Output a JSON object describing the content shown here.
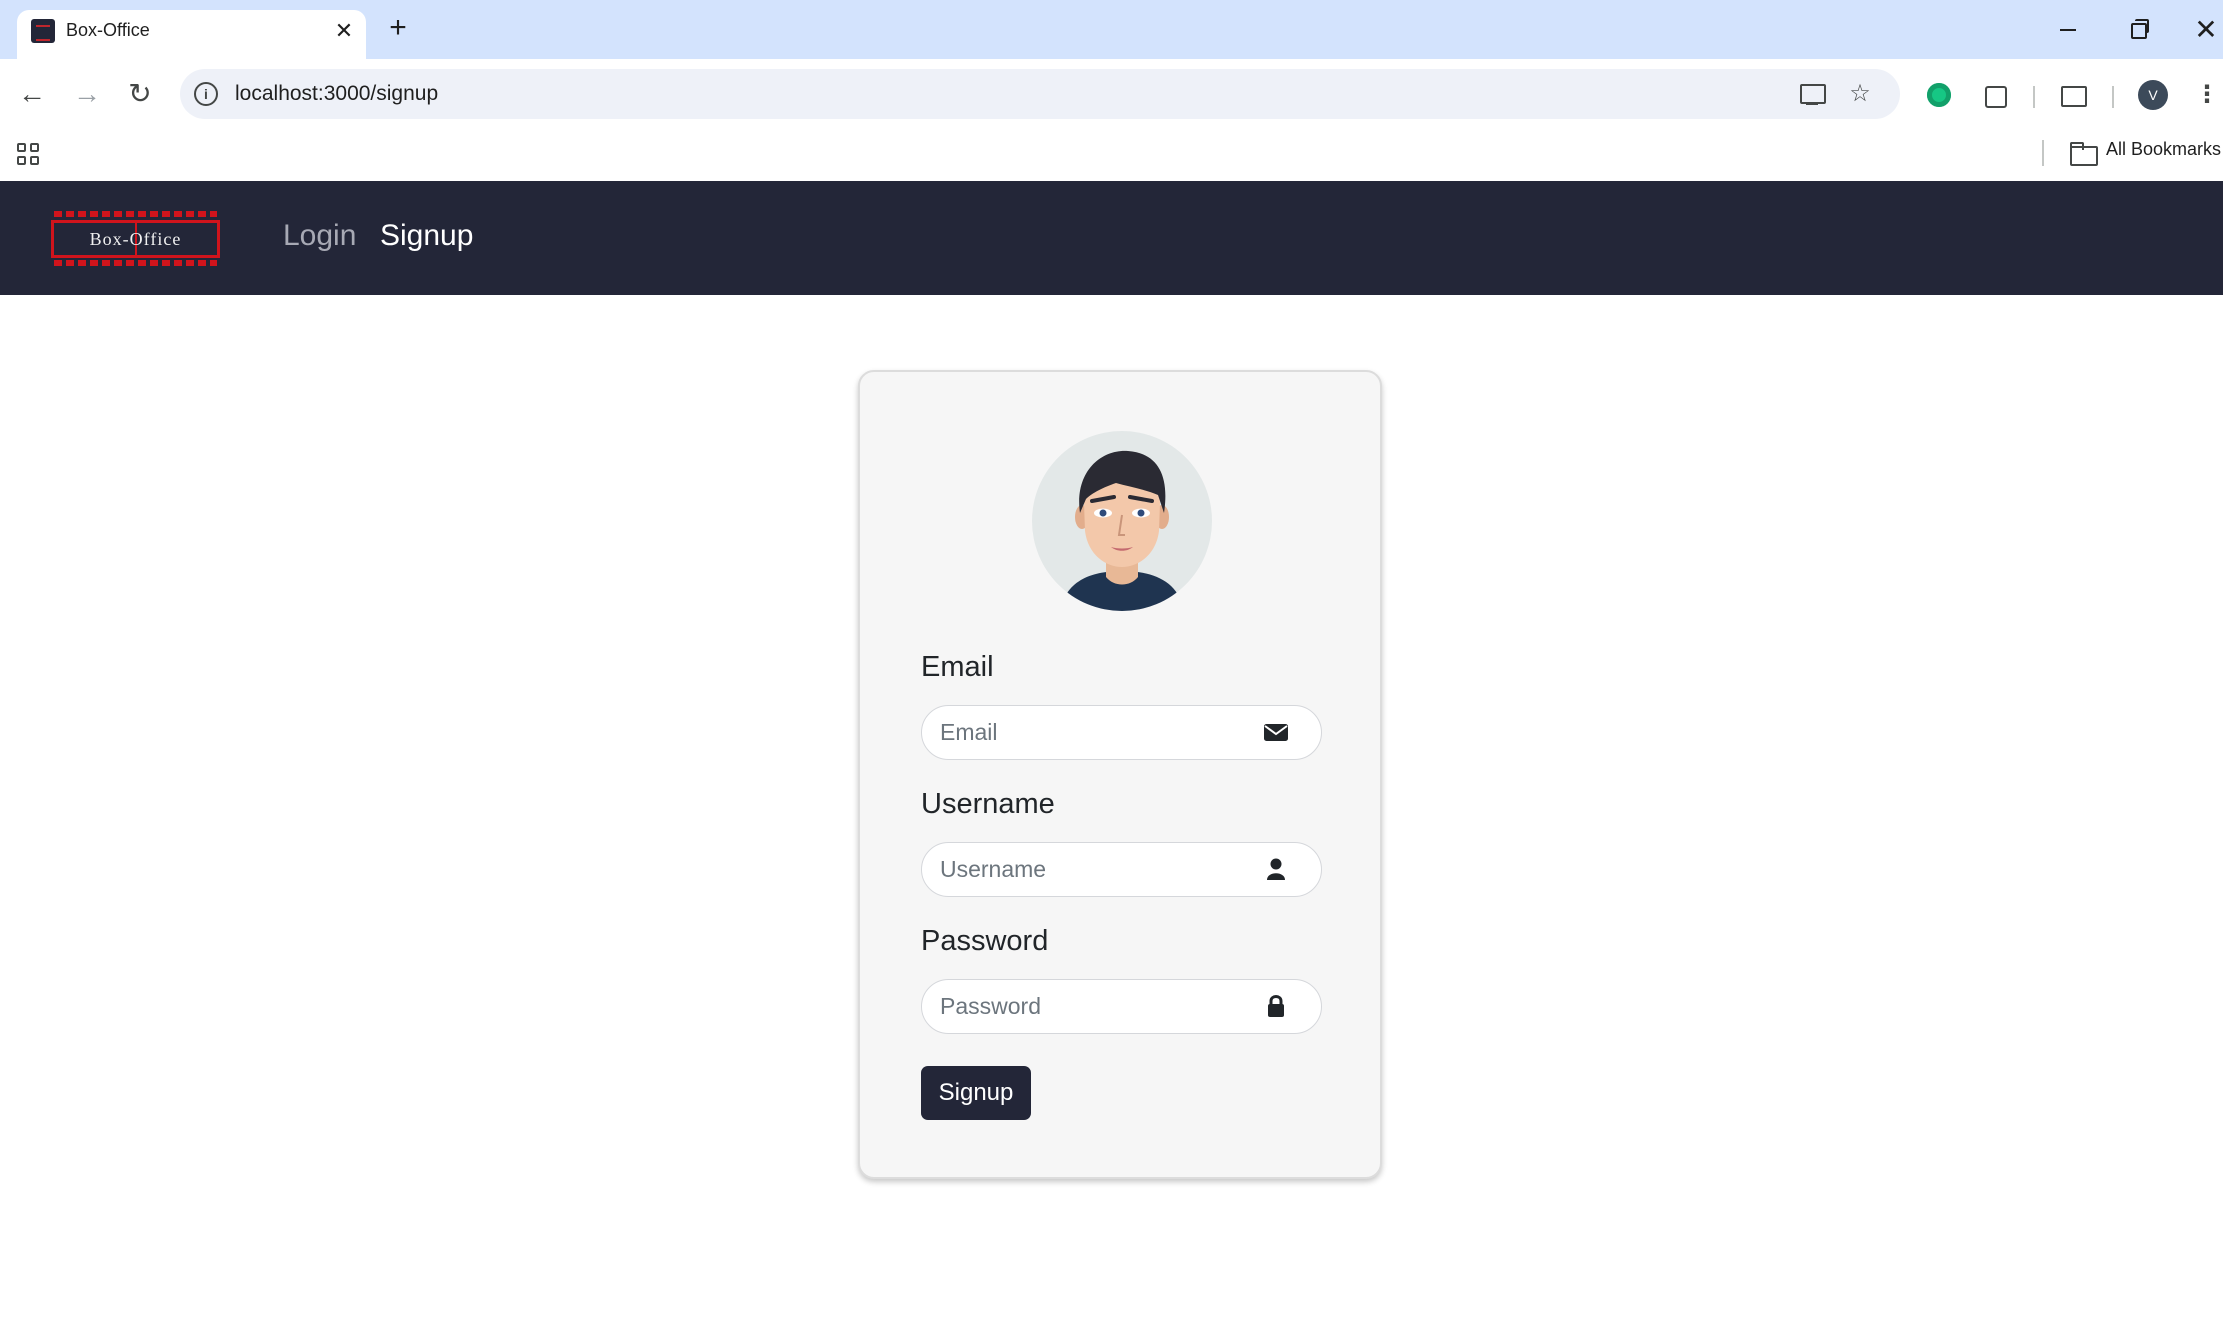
{
  "browser": {
    "tab_title": "Box-Office",
    "tab_close": "✕",
    "new_tab": "+",
    "url": "localhost:3000/signup",
    "profile_initial": "V",
    "bookmarks_label": "All Bookmarks",
    "icons": {
      "back": "←",
      "forward": "→",
      "reload": "↻",
      "info": "i",
      "star": "☆",
      "close_window": "✕",
      "menu": "⋮"
    }
  },
  "site": {
    "logo_text": "Box-Office",
    "nav": {
      "login": "Login",
      "signup": "Signup"
    }
  },
  "form": {
    "email_label": "Email",
    "email_placeholder": "Email",
    "username_label": "Username",
    "username_placeholder": "Username",
    "password_label": "Password",
    "password_placeholder": "Password",
    "submit_label": "Signup"
  },
  "colors": {
    "navbar": "#232638",
    "logo_accent": "#d0141c",
    "card_background": "#f6f6f6",
    "button": "#232638"
  }
}
